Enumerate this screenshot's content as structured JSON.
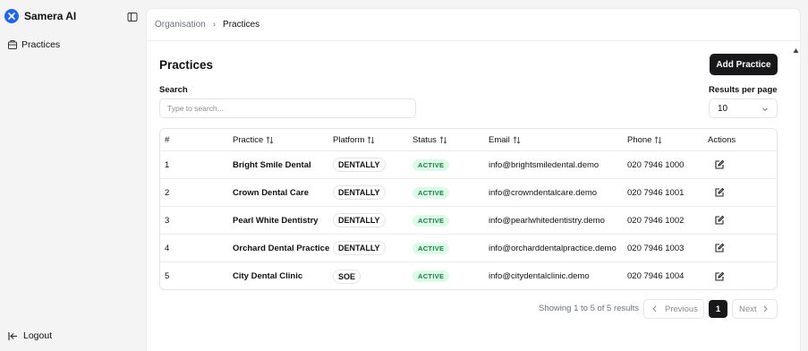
{
  "app": {
    "name": "Samera AI",
    "brand_color": "#2563eb"
  },
  "sidebar": {
    "items": [
      {
        "label": "Practices",
        "icon": "building-icon"
      }
    ],
    "logout_label": "Logout"
  },
  "breadcrumb": {
    "parent": "Organisation",
    "current": "Practices"
  },
  "page": {
    "title": "Practices",
    "add_button": "Add Practice"
  },
  "search": {
    "label": "Search",
    "placeholder": "Type to search...",
    "value": ""
  },
  "results_per_page": {
    "label": "Results per page",
    "value": "10"
  },
  "table": {
    "columns": [
      "#",
      "Practice",
      "Platform",
      "Status",
      "Email",
      "Phone",
      "Actions"
    ],
    "rows": [
      {
        "num": "1",
        "practice": "Bright Smile Dental",
        "platform": "DENTALLY",
        "status": "ACTIVE",
        "email": "info@brightsmiledental.demo",
        "phone": "020 7946 1000"
      },
      {
        "num": "2",
        "practice": "Crown Dental Care",
        "platform": "DENTALLY",
        "status": "ACTIVE",
        "email": "info@crowndentalcare.demo",
        "phone": "020 7946 1001"
      },
      {
        "num": "3",
        "practice": "Pearl White Dentistry",
        "platform": "DENTALLY",
        "status": "ACTIVE",
        "email": "info@pearlwhitedentistry.demo",
        "phone": "020 7946 1002"
      },
      {
        "num": "4",
        "practice": "Orchard Dental Practice",
        "platform": "DENTALLY",
        "status": "ACTIVE",
        "email": "info@orcharddentalpractice.demo",
        "phone": "020 7946 1003"
      },
      {
        "num": "5",
        "practice": "City Dental Clinic",
        "platform": "SOE",
        "status": "ACTIVE",
        "email": "info@citydentalclinic.demo",
        "phone": "020 7946 1004"
      }
    ]
  },
  "status_colors": {
    "active_bg": "#dcfce7",
    "active_text": "#15803d"
  },
  "pagination": {
    "summary": "Showing 1 to 5 of 5 results",
    "previous": "Previous",
    "current_page": "1",
    "next": "Next"
  }
}
